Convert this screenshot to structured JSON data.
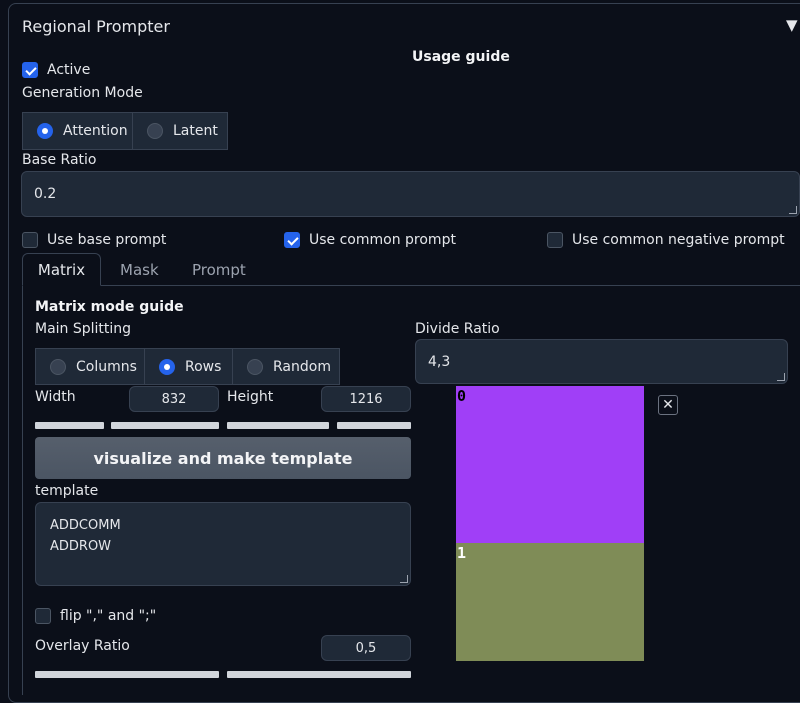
{
  "header": {
    "title": "Regional Prompter",
    "collapse_icon": "triangle-down-icon",
    "usage_guide": "Usage guide"
  },
  "active": {
    "label": "Active",
    "checked": true
  },
  "generation_mode": {
    "label": "Generation Mode",
    "options": [
      {
        "label": "Attention",
        "selected": true
      },
      {
        "label": "Latent",
        "selected": false
      }
    ]
  },
  "base_ratio": {
    "label": "Base Ratio",
    "value": "0.2"
  },
  "toggles": {
    "use_base_prompt": {
      "label": "Use base prompt",
      "checked": false
    },
    "use_common_prompt": {
      "label": "Use common prompt",
      "checked": true
    },
    "use_common_negative_prompt": {
      "label": "Use common negative prompt",
      "checked": false
    }
  },
  "tabs": [
    {
      "label": "Matrix",
      "active": true
    },
    {
      "label": "Mask",
      "active": false
    },
    {
      "label": "Prompt",
      "active": false
    }
  ],
  "matrix": {
    "guide": "Matrix mode guide",
    "main_splitting": {
      "label": "Main Splitting",
      "options": [
        {
          "label": "Columns",
          "selected": false
        },
        {
          "label": "Rows",
          "selected": true
        },
        {
          "label": "Random",
          "selected": false
        }
      ]
    },
    "width": {
      "label": "Width",
      "value": "832"
    },
    "height": {
      "label": "Height",
      "value": "1216"
    },
    "visualize_button": "visualize and make template",
    "template": {
      "label": "template",
      "lines": [
        "ADDCOMM",
        "ADDROW"
      ]
    },
    "flip": {
      "label": "flip \",\" and \";\"",
      "checked": false
    },
    "overlay_ratio": {
      "label": "Overlay Ratio",
      "value": "0,5"
    },
    "divide_ratio": {
      "label": "Divide Ratio",
      "value": "4,3"
    },
    "preview": {
      "close_icon": "close-icon",
      "regions": [
        {
          "label": "0",
          "color": "#a03ff7",
          "fraction": 0.571
        },
        {
          "label": "1",
          "color": "#7f8c57",
          "fraction": 0.429
        }
      ]
    }
  },
  "colors": {
    "accent": "#2563eb",
    "panel_bg": "#0b0f19",
    "input_bg": "#1f2937",
    "border": "#374151"
  }
}
